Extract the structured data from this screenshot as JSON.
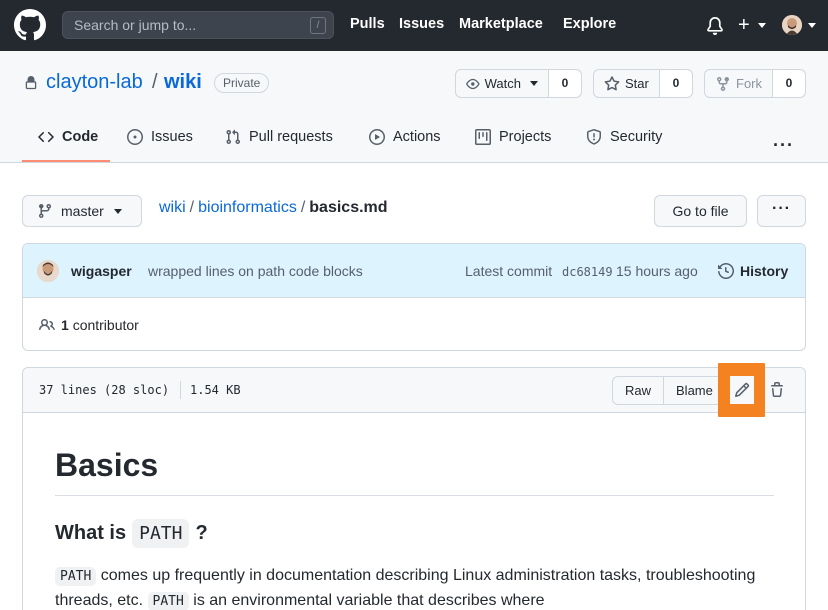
{
  "header": {
    "search_placeholder": "Search or jump to...",
    "search_shortcut": "/",
    "nav": [
      "Pulls",
      "Issues",
      "Marketplace",
      "Explore"
    ],
    "new_label": "+"
  },
  "repo": {
    "owner": "clayton-lab",
    "separator": "/",
    "name": "wiki",
    "visibility": "Private",
    "watch_label": "Watch",
    "watch_count": "0",
    "star_label": "Star",
    "star_count": "0",
    "fork_label": "Fork",
    "fork_count": "0"
  },
  "tabs": [
    {
      "label": "Code",
      "icon": "code-icon"
    },
    {
      "label": "Issues",
      "icon": "issue-icon"
    },
    {
      "label": "Pull requests",
      "icon": "pull-request-icon"
    },
    {
      "label": "Actions",
      "icon": "play-icon"
    },
    {
      "label": "Projects",
      "icon": "project-icon"
    },
    {
      "label": "Security",
      "icon": "shield-icon"
    }
  ],
  "file_nav": {
    "branch": "master",
    "crumbs": [
      "wiki",
      "bioinformatics"
    ],
    "current_file": "basics.md",
    "go_to_file": "Go to file",
    "more": "···"
  },
  "commit": {
    "author": "wigasper",
    "message": "wrapped lines on path code blocks",
    "latest_label": "Latest commit",
    "sha": "dc68149",
    "time": "15 hours ago",
    "history_label": "History",
    "contributors_count": "1",
    "contributors_label": "contributor"
  },
  "file": {
    "lines_info": "37 lines (28 sloc)",
    "size": "1.54 KB",
    "raw_label": "Raw",
    "blame_label": "Blame"
  },
  "markdown": {
    "h1": "Basics",
    "h2_prefix": "What is",
    "h2_code": "PATH",
    "h2_suffix": "?",
    "p_code1": "PATH",
    "p_text1": " comes up frequently in documentation describing Linux administration tasks, troubleshooting threads, etc. ",
    "p_code2": "PATH",
    "p_text2": " is an environmental variable that describes where"
  },
  "colors": {
    "header_bg": "#24292f",
    "link": "#0969da",
    "highlight": "#f58220",
    "commit_bg": "#ddf4ff",
    "tab_underline": "#fd8c73"
  }
}
